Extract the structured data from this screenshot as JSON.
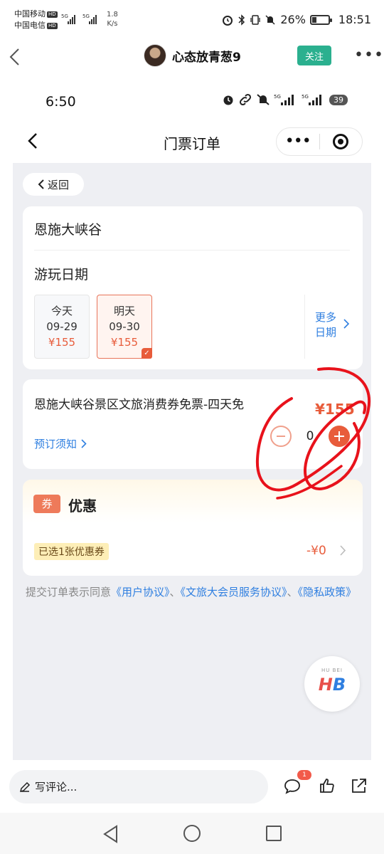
{
  "status_bar": {
    "carrier_1": "中国移动",
    "carrier_2": "中国电信",
    "hd_badge": "HD",
    "net_5g": "5G",
    "speed_value": "1.8",
    "speed_unit": "K/s",
    "battery": "26%",
    "time": "18:51",
    "icons": [
      "alarm-icon",
      "bluetooth-icon",
      "vibrate-icon",
      "mute-icon",
      "battery-icon"
    ]
  },
  "post_header": {
    "username": "心态放青葱9",
    "follow_label": "关注",
    "more_label": "•••"
  },
  "inner_status": {
    "time": "6:50",
    "net_1": "5G",
    "net_2": "5G",
    "battery": "39"
  },
  "inner_nav": {
    "title": "门票订单",
    "capsule_more": "•••"
  },
  "page": {
    "back_label": "返回",
    "scenic_name": "恩施大峡谷",
    "date_section_label": "游玩日期",
    "dates": [
      {
        "day": "今天",
        "date": "09-29",
        "price": "¥155",
        "selected": false
      },
      {
        "day": "明天",
        "date": "09-30",
        "price": "¥155",
        "selected": true
      }
    ],
    "more_dates_line1": "更多",
    "more_dates_line2": "日期",
    "ticket": {
      "name": "恩施大峡谷景区文旅消费券免票-四天免",
      "booking_note": "预订须知",
      "price": "¥155",
      "quantity": "0"
    },
    "coupon": {
      "badge": "券",
      "title": "优惠",
      "selected_text": "已选1张优惠券",
      "value": "-¥0"
    },
    "agreement": {
      "prefix": "提交订单表示同意",
      "link_1": "《用户协议》",
      "sep_1": "、",
      "link_2": "《文旅大会员服务协议》",
      "sep_2": "、",
      "link_3": "《隐私政策》"
    },
    "logo": {
      "top_text": "HU BEI",
      "mark": "HB"
    }
  },
  "bottom_bar": {
    "comment_placeholder": "写评论...",
    "comment_count": "1"
  },
  "colors": {
    "accent": "#e85c3b",
    "link": "#2f7fe0",
    "follow": "#2bb08f",
    "annotation": "#e8121b"
  }
}
